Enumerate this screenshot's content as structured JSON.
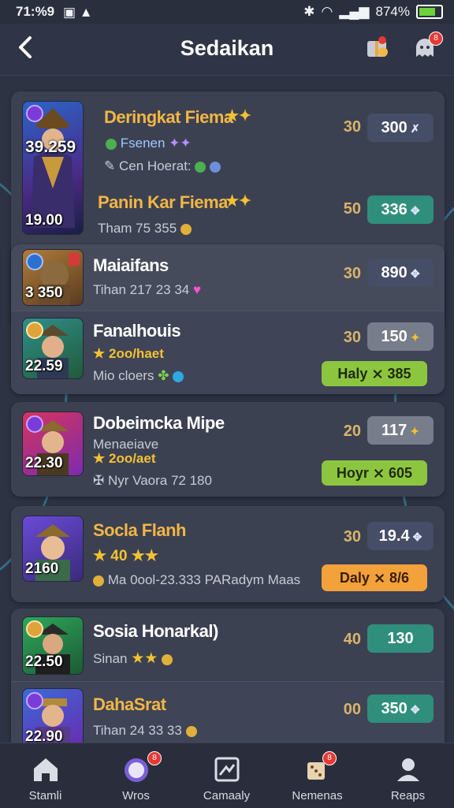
{
  "status": {
    "time": "71:%9",
    "battery": "874%"
  },
  "header": {
    "title": "Sedaikan",
    "badge1": "",
    "badge2": "8"
  },
  "groups": [
    {
      "rows": [
        {
          "name": "Deringkat Fiema",
          "stars": "★✦",
          "sub1": "Fsenen",
          "sub2": "Cen Hoerat:",
          "avatar_level": "39.259",
          "num": "30",
          "pill": "300",
          "pill_icon": "✗",
          "pill_style": "dark"
        },
        {
          "name": "Panin Kar Fiema",
          "stars": "★✦",
          "sub1": "Tham 75 355",
          "num": "50",
          "pill": "336",
          "pill_icon": "✥",
          "pill_style": "teal",
          "avatar_level": "19.00"
        }
      ]
    },
    {
      "rows": [
        {
          "name": "Maiaifans",
          "sub1": "Tihan 217 23 34",
          "avatar_level": "3 350",
          "num": "30",
          "pill": "890",
          "pill_icon": "✥",
          "pill_style": "dark"
        },
        {
          "name": "Fanalhouis",
          "stars": "★",
          "stars_text": "2oo/haet",
          "sub1": "Mio cloers",
          "avatar_level": "22.59",
          "num": "30",
          "pill": "150",
          "pill_icon": "✦",
          "pill_style": "gray",
          "action": "Haly ⨯ 385",
          "action_style": "lime"
        }
      ]
    },
    {
      "rows": [
        {
          "name": "Dobeimcka Mipe",
          "sub0": "Menaeiave",
          "stars": "★",
          "stars_text": "2oo/aet",
          "sub1": "Nyr Vaora 72 180",
          "avatar_level": "22.30",
          "num": "20",
          "pill": "117",
          "pill_icon": "✦",
          "pill_style": "gray",
          "action": "Hoyr ⨯ 605",
          "action_style": "lime"
        }
      ]
    },
    {
      "rows": [
        {
          "name": "Socla Flanh",
          "stars": "★ 40 ★★",
          "sub1": "Ma 0ool-23.333 PARadym Maas",
          "avatar_level": "2160",
          "num": "30",
          "pill": "19.4",
          "pill_icon": "✥",
          "pill_style": "dark",
          "action": "Daly ⨯ 8/6",
          "action_style": "orange"
        }
      ]
    },
    {
      "rows": [
        {
          "name": "Sosia Honarkal)",
          "sub1": "Sinan",
          "avatar_level": "22.50",
          "num": "40",
          "pill": "130",
          "pill_style": "teal",
          "pill_icon": ""
        },
        {
          "name": "DahaSrat",
          "sub1": "Tihan 24 33 33",
          "avatar_level": "22.90",
          "num": "00",
          "pill": "350",
          "pill_icon": "✥",
          "pill_style": "teal"
        }
      ]
    }
  ],
  "nav": [
    {
      "label": "Stamli",
      "icon": "home-icon",
      "badge": ""
    },
    {
      "label": "Wros",
      "icon": "compass-icon",
      "badge": "8"
    },
    {
      "label": "Camaaly",
      "icon": "card-icon",
      "badge": ""
    },
    {
      "label": "Nemenas",
      "icon": "dice-icon",
      "badge": "8"
    },
    {
      "label": "Reaps",
      "icon": "person-icon",
      "badge": ""
    }
  ]
}
